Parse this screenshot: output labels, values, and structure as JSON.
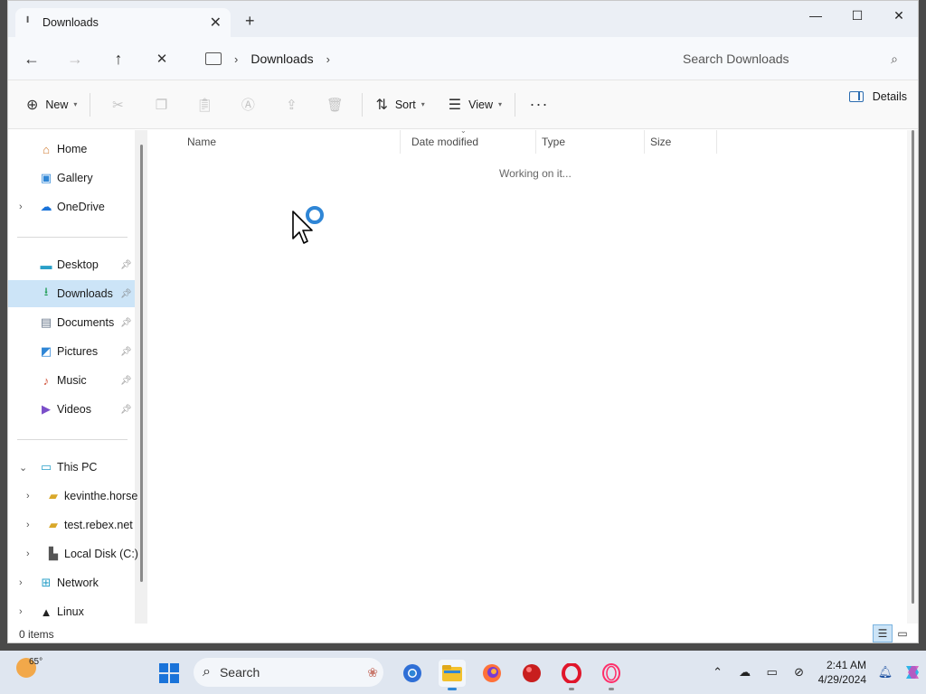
{
  "window": {
    "tab_title": "Downloads",
    "tab_close": "✕",
    "new_tab": "+",
    "controls": {
      "minimize": "—",
      "maximize": "☐",
      "close": "✕"
    }
  },
  "address": {
    "back": "←",
    "forward": "→",
    "up": "↑",
    "stop": "✕",
    "breadcrumb": [
      "Downloads"
    ],
    "search_placeholder": "Search Downloads"
  },
  "toolbar": {
    "new_label": "New",
    "sort_label": "Sort",
    "view_label": "View",
    "more": "···",
    "details_label": "Details"
  },
  "nav": {
    "quick": [
      {
        "label": "Home",
        "icon": "home-icon"
      },
      {
        "label": "Gallery",
        "icon": "gallery-icon"
      },
      {
        "label": "OneDrive",
        "icon": "cloud-icon"
      }
    ],
    "pinned": [
      {
        "label": "Desktop",
        "icon": "desktop-icon"
      },
      {
        "label": "Downloads",
        "icon": "download-icon",
        "selected": true
      },
      {
        "label": "Documents",
        "icon": "document-icon"
      },
      {
        "label": "Pictures",
        "icon": "picture-icon"
      },
      {
        "label": "Music",
        "icon": "music-icon"
      },
      {
        "label": "Videos",
        "icon": "video-icon"
      }
    ],
    "tree": [
      {
        "label": "This PC",
        "icon": "pc-icon"
      },
      {
        "label": "kevinthe.horse",
        "icon": "network-drive-icon"
      },
      {
        "label": "test.rebex.net",
        "icon": "network-drive-icon"
      },
      {
        "label": "Local Disk (C:)",
        "icon": "disk-icon"
      },
      {
        "label": "Network",
        "icon": "network-icon"
      },
      {
        "label": "Linux",
        "icon": "linux-icon"
      }
    ]
  },
  "columns": [
    "Name",
    "Date modified",
    "Type",
    "Size"
  ],
  "status_message": "Working on it...",
  "statusbar": {
    "items_count": "0 items"
  },
  "taskbar": {
    "temperature": "65°",
    "search_label": "Search",
    "time": "2:41 AM",
    "date": "4/29/2024"
  },
  "colors": {
    "accent": "#2f86d6",
    "selection": "#cce4f7",
    "start_blue": "#1a73d9"
  }
}
